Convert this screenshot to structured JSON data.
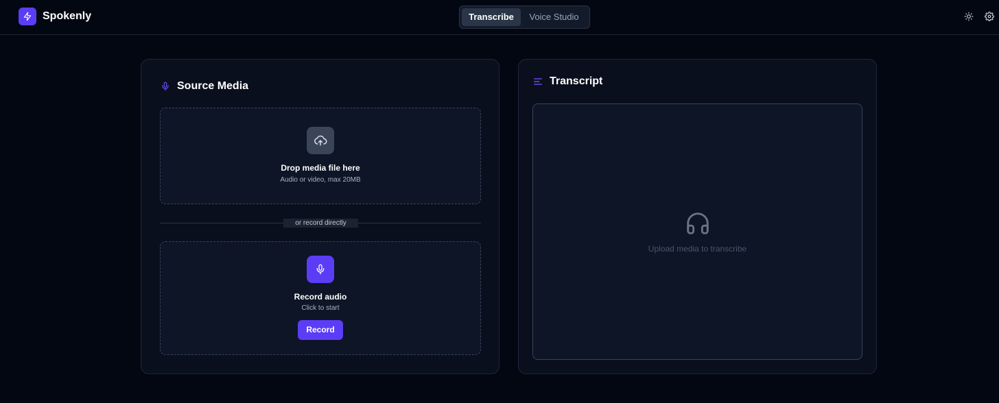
{
  "app": {
    "name": "Spokenly",
    "accent_color": "#5b3df5",
    "logo_icon": "lightning-bolt-icon"
  },
  "tabs": [
    {
      "label": "Transcribe",
      "active": true
    },
    {
      "label": "Voice Studio",
      "active": false
    }
  ],
  "header_icons": [
    "sun-icon",
    "gear-icon"
  ],
  "source_media": {
    "title": "Source Media",
    "title_icon": "microphone-icon",
    "upload": {
      "icon": "cloud-upload-icon",
      "title": "Drop media file here",
      "subtitle": "Audio or video, max 20MB"
    },
    "divider_label": "or record directly",
    "record": {
      "icon": "microphone-icon",
      "title": "Record audio",
      "subtitle": "Click to start",
      "button_label": "Record"
    }
  },
  "transcript": {
    "title": "Transcript",
    "title_icon": "lines-icon",
    "empty_icon": "headphones-icon",
    "empty_text": "Upload media to transcribe"
  }
}
